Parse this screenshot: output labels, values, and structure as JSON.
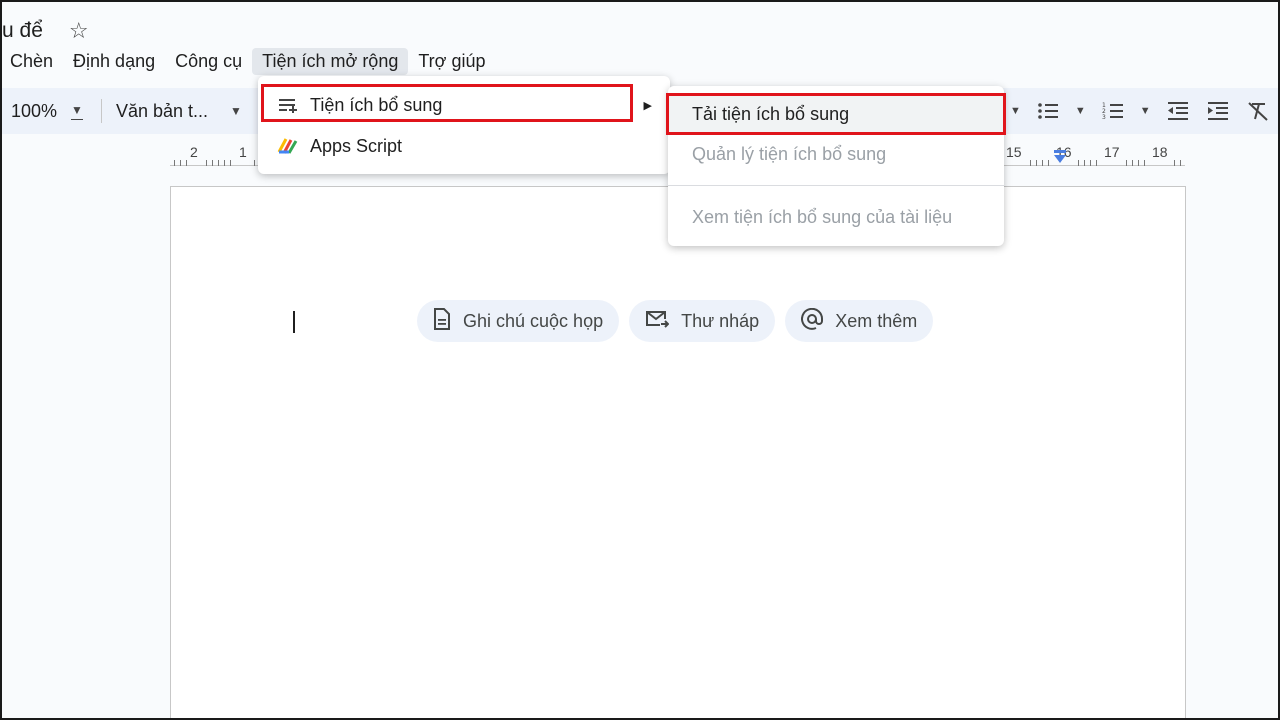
{
  "document": {
    "title": "u để",
    "star_icon": "star-icon"
  },
  "menubar": {
    "items": [
      "Chèn",
      "Định dạng",
      "Công cụ",
      "Tiện ích mở rộng",
      "Trợ giúp"
    ],
    "active": "Tiện ích mở rộng"
  },
  "toolbar": {
    "zoom": "100%",
    "style": "Văn bản t...",
    "icons": [
      "bulleted-list-icon",
      "numbered-list-icon",
      "decrease-indent-icon",
      "increase-indent-icon",
      "clear-formatting-icon"
    ]
  },
  "ruler": {
    "numbers": [
      "2",
      "1",
      "15",
      "16",
      "17",
      "18"
    ]
  },
  "page": {
    "chips": [
      {
        "label": "Ghi chú cuộc họp",
        "icon": "document-icon"
      },
      {
        "label": "Thư nháp",
        "icon": "mail-draft-icon"
      },
      {
        "label": "Xem thêm",
        "icon": "at-sign-icon"
      }
    ]
  },
  "extensions_menu": {
    "items": [
      {
        "label": "Tiện ích bổ sung",
        "icon": "add-ons-icon",
        "has_submenu": true,
        "highlighted": true
      },
      {
        "label": "Apps Script",
        "icon": "apps-script-icon",
        "has_submenu": false
      }
    ]
  },
  "addons_submenu": {
    "items": [
      {
        "label": "Tải tiện ích bổ sung",
        "disabled": false,
        "highlighted": true
      },
      {
        "label": "Quản lý tiện ích bổ sung",
        "disabled": true
      },
      {
        "label": "Xem tiện ích bổ sung của tài liệu",
        "disabled": true
      }
    ]
  },
  "colors": {
    "highlight_box": "#e0141b",
    "toolbar_bg": "#edf2fa",
    "chip_bg": "#edf2fa",
    "ruler_marker": "#4a7de0"
  }
}
